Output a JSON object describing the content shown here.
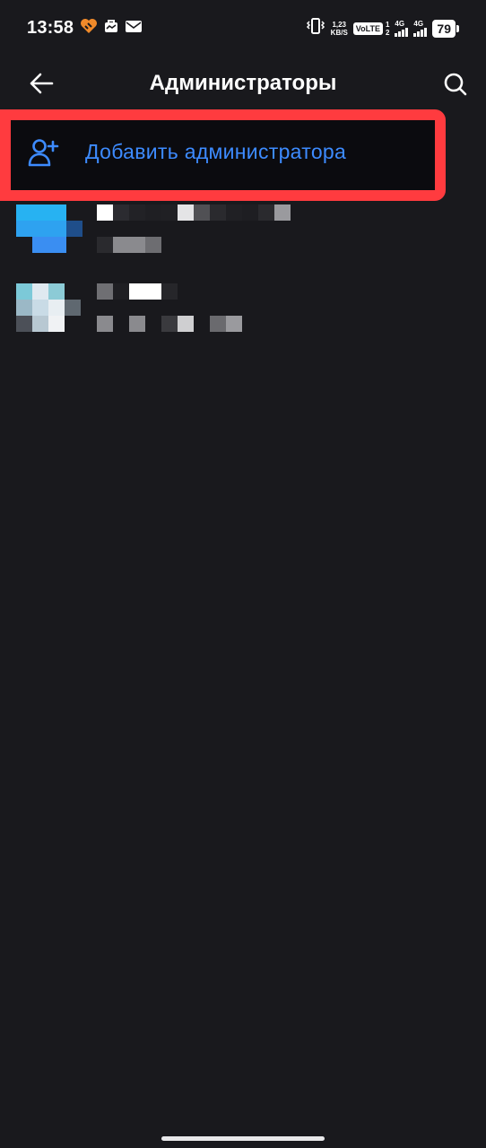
{
  "status_bar": {
    "time": "13:58",
    "net_speed_value": "1,23",
    "net_speed_unit": "KB/S",
    "volte": "VoLTE",
    "sim1_index": "1",
    "sim2_index": "2",
    "network_1": "4G",
    "network_2": "4G",
    "battery": "79"
  },
  "header": {
    "title": "Администраторы",
    "back_icon": "arrow-left-icon",
    "search_icon": "search-icon"
  },
  "add_admin": {
    "label": "Добавить администратора",
    "icon": "add-person-icon",
    "highlight_color": "#ff3b3f",
    "accent_color": "#3d8bff"
  },
  "admins": [
    {
      "avatar": "pixelated",
      "name": "pixelated",
      "subtitle": "pixelated"
    },
    {
      "avatar": "pixelated",
      "name": "pixelated",
      "subtitle": "pixelated"
    }
  ]
}
